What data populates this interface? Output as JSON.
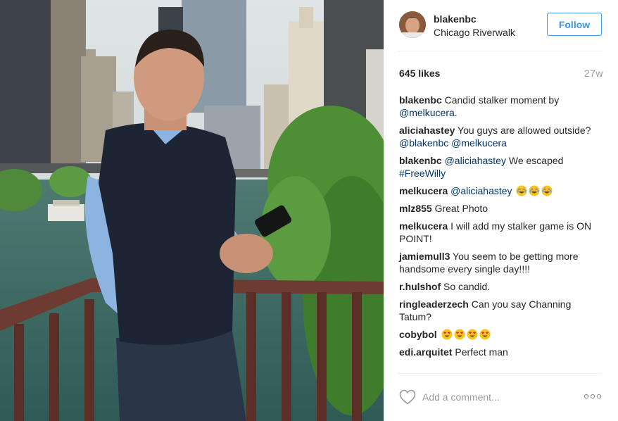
{
  "post": {
    "username": "blakenbc",
    "location": "Chicago Riverwalk",
    "follow_label": "Follow",
    "likes": "645 likes",
    "age": "27w",
    "avatar_icon": "profile-avatar",
    "photo_description_icon": "photo"
  },
  "comments": [
    {
      "author": "blakenbc",
      "parts": [
        {
          "type": "text",
          "value": " Candid stalker moment by "
        },
        {
          "type": "mention",
          "value": "@melkucera"
        },
        {
          "type": "text",
          "value": "."
        }
      ]
    },
    {
      "author": "aliciahastey",
      "parts": [
        {
          "type": "text",
          "value": " You guys are allowed outside? "
        },
        {
          "type": "mention",
          "value": "@blakenbc"
        },
        {
          "type": "text",
          "value": " "
        },
        {
          "type": "mention",
          "value": "@melkucera"
        }
      ]
    },
    {
      "author": "blakenbc",
      "parts": [
        {
          "type": "text",
          "value": " "
        },
        {
          "type": "mention",
          "value": "@aliciahastey"
        },
        {
          "type": "text",
          "value": " We escaped "
        },
        {
          "type": "mention",
          "value": "#FreeWilly"
        }
      ]
    },
    {
      "author": "melkucera",
      "parts": [
        {
          "type": "text",
          "value": " "
        },
        {
          "type": "mention",
          "value": "@aliciahastey"
        },
        {
          "type": "text",
          "value": " "
        },
        {
          "type": "emoji",
          "value": "tears-of-joy-emoji"
        },
        {
          "type": "emoji",
          "value": "tears-of-joy-emoji"
        },
        {
          "type": "emoji",
          "value": "tears-of-joy-emoji"
        }
      ]
    },
    {
      "author": "mlz855",
      "parts": [
        {
          "type": "text",
          "value": " Great Photo"
        }
      ]
    },
    {
      "author": "melkucera",
      "parts": [
        {
          "type": "text",
          "value": " I will add my stalker game is ON POINT!"
        }
      ]
    },
    {
      "author": "jamiemull3",
      "parts": [
        {
          "type": "text",
          "value": " You seem to be getting more handsome every single day!!!!"
        }
      ]
    },
    {
      "author": "r.hulshof",
      "parts": [
        {
          "type": "text",
          "value": " So candid."
        }
      ]
    },
    {
      "author": "ringleaderzech",
      "parts": [
        {
          "type": "text",
          "value": " Can you say Channing Tatum?"
        }
      ]
    },
    {
      "author": "cobybol",
      "parts": [
        {
          "type": "text",
          "value": " "
        },
        {
          "type": "emoji",
          "value": "heart-eyes-emoji"
        },
        {
          "type": "emoji",
          "value": "heart-eyes-emoji"
        },
        {
          "type": "emoji",
          "value": "heart-eyes-emoji"
        },
        {
          "type": "emoji",
          "value": "heart-eyes-emoji"
        }
      ]
    },
    {
      "author": "edi.arquitet",
      "parts": [
        {
          "type": "text",
          "value": " Perfect man"
        }
      ]
    }
  ],
  "footer": {
    "comment_placeholder": "Add a comment...",
    "like_icon": "heart-icon",
    "more_icon": "more-options-icon"
  },
  "colors": {
    "accent": "#3897f0",
    "mention": "#003569",
    "muted": "#999999",
    "text": "#262626",
    "divider": "#efefef"
  }
}
